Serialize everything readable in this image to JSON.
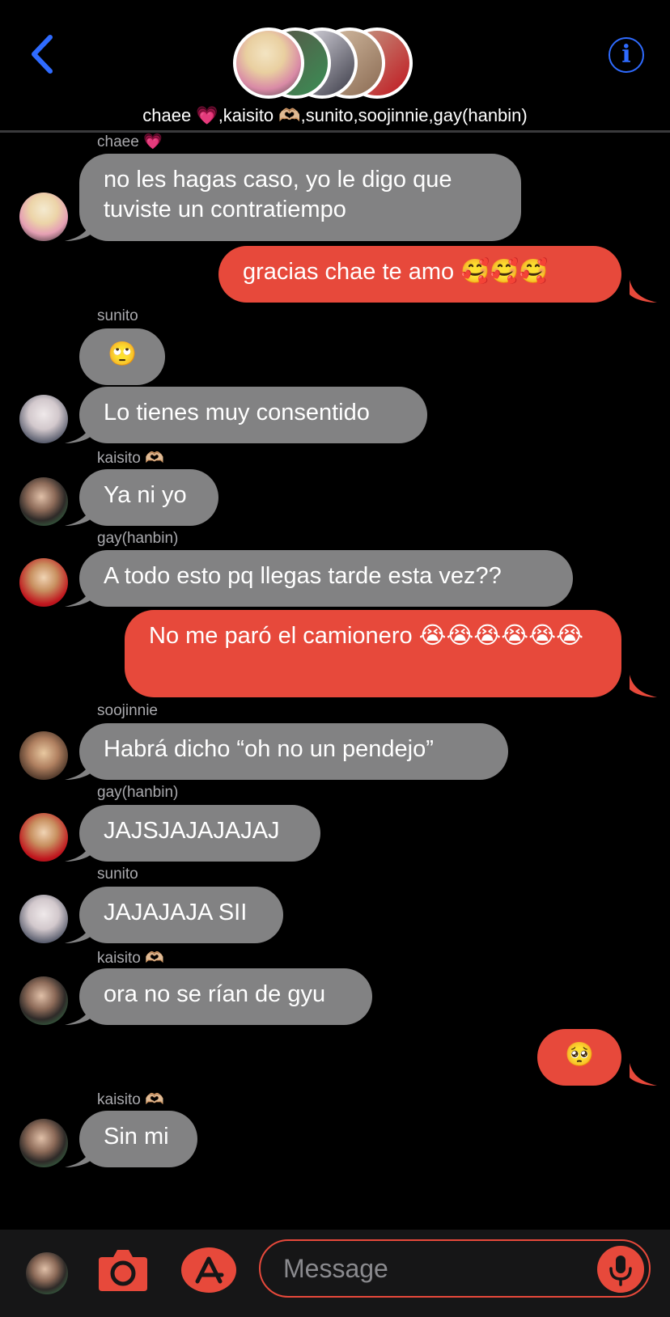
{
  "header": {
    "group_names": "chaee 💗,kaisito 🫶🏼,sunito,soojinnie,gay(hanbin)",
    "info_glyph": "i",
    "back_icon": "chevron-left-icon",
    "accent_color": "#2f6bff"
  },
  "colors": {
    "incoming_bubble": "#828283",
    "outgoing_bubble": "#e7493b",
    "background": "#000000"
  },
  "messages": [
    {
      "sender": "chaee 💗",
      "text": "no les hagas caso, yo le digo que tuviste un contratiempo",
      "direction": "incoming"
    },
    {
      "text": "gracias chae te amo 🥰🥰🥰",
      "direction": "outgoing"
    },
    {
      "sender": "sunito",
      "text": "🙄",
      "direction": "incoming"
    },
    {
      "text": "Lo tienes muy consentido",
      "direction": "incoming"
    },
    {
      "sender": "kaisito 🫶🏼",
      "text": "Ya ni yo",
      "direction": "incoming"
    },
    {
      "sender": "gay(hanbin)",
      "text": "A todo esto pq llegas tarde esta vez??",
      "direction": "incoming"
    },
    {
      "text": "No me paró el camionero 😭😭😭😭😭😭",
      "direction": "outgoing"
    },
    {
      "sender": "soojinnie",
      "text": "Habrá dicho “oh no un pendejo”",
      "direction": "incoming"
    },
    {
      "sender": "gay(hanbin)",
      "text": "JAJSJAJAJAJAJ",
      "direction": "incoming"
    },
    {
      "sender": "sunito",
      "text": "JAJAJAJA SII",
      "direction": "incoming"
    },
    {
      "sender": "kaisito 🫶🏼",
      "text": "ora no se rían de gyu",
      "direction": "incoming"
    },
    {
      "text": "🥺",
      "direction": "outgoing"
    },
    {
      "sender": "kaisito 🫶🏼",
      "text": "Sin mi",
      "direction": "incoming"
    }
  ],
  "composer": {
    "placeholder": "Message",
    "camera_icon": "camera-icon",
    "apps_icon": "app-store-icon",
    "mic_icon": "microphone-icon"
  }
}
